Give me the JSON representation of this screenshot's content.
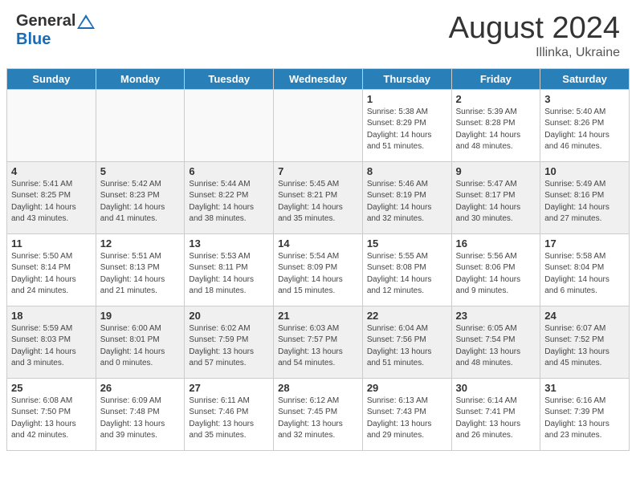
{
  "header": {
    "logo_general": "General",
    "logo_blue": "Blue",
    "month_year": "August 2024",
    "location": "Illinka, Ukraine"
  },
  "days_of_week": [
    "Sunday",
    "Monday",
    "Tuesday",
    "Wednesday",
    "Thursday",
    "Friday",
    "Saturday"
  ],
  "weeks": [
    [
      {
        "day": "",
        "info": "",
        "empty": true
      },
      {
        "day": "",
        "info": "",
        "empty": true
      },
      {
        "day": "",
        "info": "",
        "empty": true
      },
      {
        "day": "",
        "info": "",
        "empty": true
      },
      {
        "day": "1",
        "info": "Sunrise: 5:38 AM\nSunset: 8:29 PM\nDaylight: 14 hours\nand 51 minutes.",
        "empty": false
      },
      {
        "day": "2",
        "info": "Sunrise: 5:39 AM\nSunset: 8:28 PM\nDaylight: 14 hours\nand 48 minutes.",
        "empty": false
      },
      {
        "day": "3",
        "info": "Sunrise: 5:40 AM\nSunset: 8:26 PM\nDaylight: 14 hours\nand 46 minutes.",
        "empty": false
      }
    ],
    [
      {
        "day": "4",
        "info": "Sunrise: 5:41 AM\nSunset: 8:25 PM\nDaylight: 14 hours\nand 43 minutes.",
        "empty": false
      },
      {
        "day": "5",
        "info": "Sunrise: 5:42 AM\nSunset: 8:23 PM\nDaylight: 14 hours\nand 41 minutes.",
        "empty": false
      },
      {
        "day": "6",
        "info": "Sunrise: 5:44 AM\nSunset: 8:22 PM\nDaylight: 14 hours\nand 38 minutes.",
        "empty": false
      },
      {
        "day": "7",
        "info": "Sunrise: 5:45 AM\nSunset: 8:21 PM\nDaylight: 14 hours\nand 35 minutes.",
        "empty": false
      },
      {
        "day": "8",
        "info": "Sunrise: 5:46 AM\nSunset: 8:19 PM\nDaylight: 14 hours\nand 32 minutes.",
        "empty": false
      },
      {
        "day": "9",
        "info": "Sunrise: 5:47 AM\nSunset: 8:17 PM\nDaylight: 14 hours\nand 30 minutes.",
        "empty": false
      },
      {
        "day": "10",
        "info": "Sunrise: 5:49 AM\nSunset: 8:16 PM\nDaylight: 14 hours\nand 27 minutes.",
        "empty": false
      }
    ],
    [
      {
        "day": "11",
        "info": "Sunrise: 5:50 AM\nSunset: 8:14 PM\nDaylight: 14 hours\nand 24 minutes.",
        "empty": false
      },
      {
        "day": "12",
        "info": "Sunrise: 5:51 AM\nSunset: 8:13 PM\nDaylight: 14 hours\nand 21 minutes.",
        "empty": false
      },
      {
        "day": "13",
        "info": "Sunrise: 5:53 AM\nSunset: 8:11 PM\nDaylight: 14 hours\nand 18 minutes.",
        "empty": false
      },
      {
        "day": "14",
        "info": "Sunrise: 5:54 AM\nSunset: 8:09 PM\nDaylight: 14 hours\nand 15 minutes.",
        "empty": false
      },
      {
        "day": "15",
        "info": "Sunrise: 5:55 AM\nSunset: 8:08 PM\nDaylight: 14 hours\nand 12 minutes.",
        "empty": false
      },
      {
        "day": "16",
        "info": "Sunrise: 5:56 AM\nSunset: 8:06 PM\nDaylight: 14 hours\nand 9 minutes.",
        "empty": false
      },
      {
        "day": "17",
        "info": "Sunrise: 5:58 AM\nSunset: 8:04 PM\nDaylight: 14 hours\nand 6 minutes.",
        "empty": false
      }
    ],
    [
      {
        "day": "18",
        "info": "Sunrise: 5:59 AM\nSunset: 8:03 PM\nDaylight: 14 hours\nand 3 minutes.",
        "empty": false
      },
      {
        "day": "19",
        "info": "Sunrise: 6:00 AM\nSunset: 8:01 PM\nDaylight: 14 hours\nand 0 minutes.",
        "empty": false
      },
      {
        "day": "20",
        "info": "Sunrise: 6:02 AM\nSunset: 7:59 PM\nDaylight: 13 hours\nand 57 minutes.",
        "empty": false
      },
      {
        "day": "21",
        "info": "Sunrise: 6:03 AM\nSunset: 7:57 PM\nDaylight: 13 hours\nand 54 minutes.",
        "empty": false
      },
      {
        "day": "22",
        "info": "Sunrise: 6:04 AM\nSunset: 7:56 PM\nDaylight: 13 hours\nand 51 minutes.",
        "empty": false
      },
      {
        "day": "23",
        "info": "Sunrise: 6:05 AM\nSunset: 7:54 PM\nDaylight: 13 hours\nand 48 minutes.",
        "empty": false
      },
      {
        "day": "24",
        "info": "Sunrise: 6:07 AM\nSunset: 7:52 PM\nDaylight: 13 hours\nand 45 minutes.",
        "empty": false
      }
    ],
    [
      {
        "day": "25",
        "info": "Sunrise: 6:08 AM\nSunset: 7:50 PM\nDaylight: 13 hours\nand 42 minutes.",
        "empty": false
      },
      {
        "day": "26",
        "info": "Sunrise: 6:09 AM\nSunset: 7:48 PM\nDaylight: 13 hours\nand 39 minutes.",
        "empty": false
      },
      {
        "day": "27",
        "info": "Sunrise: 6:11 AM\nSunset: 7:46 PM\nDaylight: 13 hours\nand 35 minutes.",
        "empty": false
      },
      {
        "day": "28",
        "info": "Sunrise: 6:12 AM\nSunset: 7:45 PM\nDaylight: 13 hours\nand 32 minutes.",
        "empty": false
      },
      {
        "day": "29",
        "info": "Sunrise: 6:13 AM\nSunset: 7:43 PM\nDaylight: 13 hours\nand 29 minutes.",
        "empty": false
      },
      {
        "day": "30",
        "info": "Sunrise: 6:14 AM\nSunset: 7:41 PM\nDaylight: 13 hours\nand 26 minutes.",
        "empty": false
      },
      {
        "day": "31",
        "info": "Sunrise: 6:16 AM\nSunset: 7:39 PM\nDaylight: 13 hours\nand 23 minutes.",
        "empty": false
      }
    ]
  ]
}
